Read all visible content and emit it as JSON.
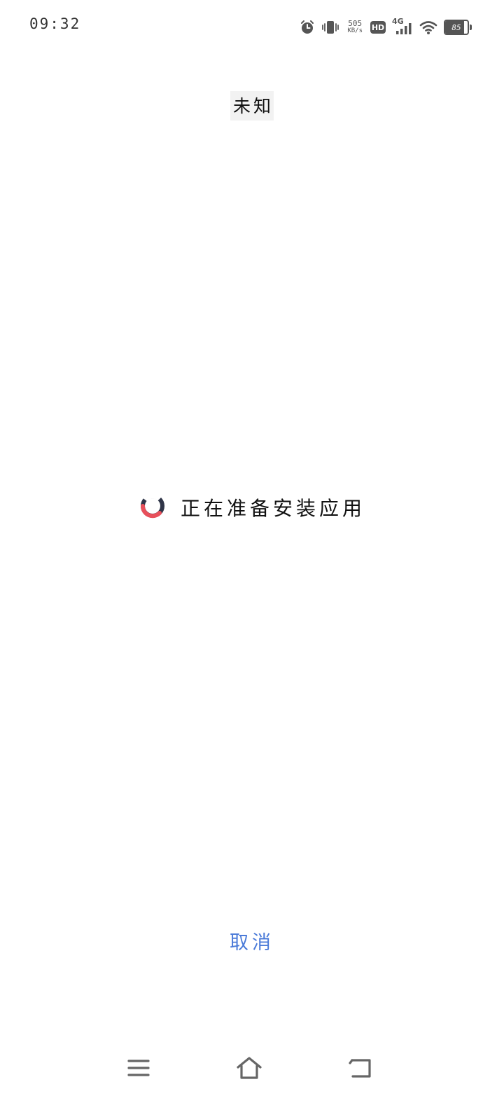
{
  "status_bar": {
    "time": "09:32",
    "net_speed_value": "505",
    "net_speed_unit": "KB/s",
    "hd_label": "HD",
    "network_type": "4G",
    "battery_level": "85",
    "battery_fraction": 0.85
  },
  "installer": {
    "app_name": "未知",
    "status_text": "正在准备安装应用",
    "cancel_label": "取消"
  },
  "nav_bar": {
    "buttons": [
      "menu-icon",
      "home-icon",
      "back-icon"
    ]
  },
  "colors": {
    "accent": "#4a7ad8",
    "spinner_dark": "#2f3548",
    "spinner_accent": "#e8505b",
    "icon_gray": "#555555"
  }
}
